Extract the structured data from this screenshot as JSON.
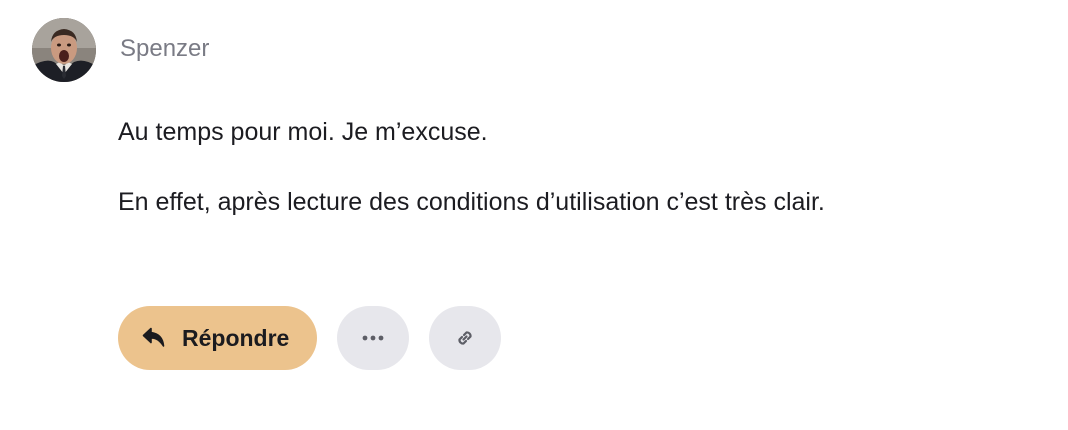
{
  "post": {
    "author": "Spenzer",
    "avatar_icon": "user-avatar-photo",
    "paragraphs": [
      "Au temps pour moi. Je m’excuse.",
      "En effet, après lecture des conditions d’utilisation c’est très clair."
    ]
  },
  "actions": {
    "reply_label": "Répondre",
    "reply_icon": "reply-arrow-icon",
    "more_icon": "ellipsis-icon",
    "link_icon": "link-icon"
  },
  "colors": {
    "reply_button": "#ecc38d",
    "round_button": "#e7e7ec",
    "author_text": "#7a7b85",
    "body_text": "#1c1c21"
  }
}
